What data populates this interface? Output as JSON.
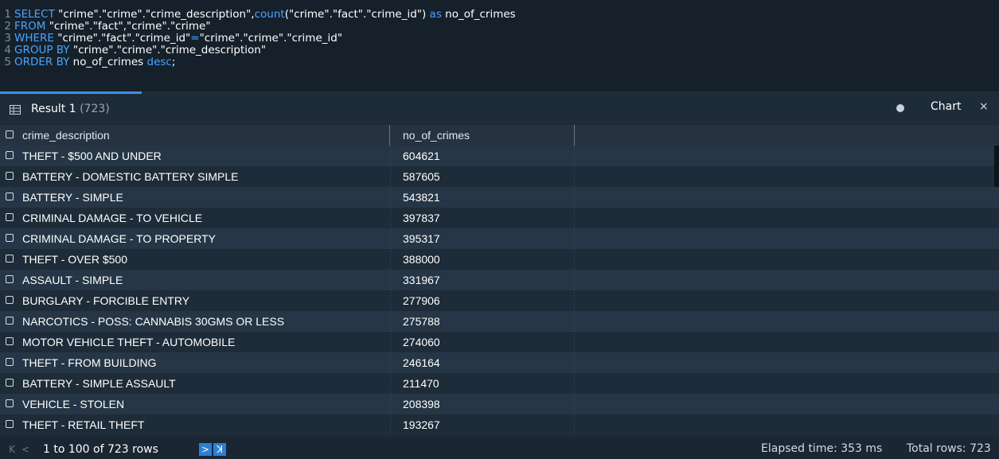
{
  "editor": {
    "lines": [
      {
        "num": "1",
        "parts": [
          {
            "t": "SELECT",
            "k": true
          },
          {
            "t": " \"crime\".\"crime\".\"crime_description\",",
            "k": false
          },
          {
            "t": "count",
            "k": true
          },
          {
            "t": "(\"crime\".\"fact\".\"crime_id\") ",
            "k": false
          },
          {
            "t": "as",
            "k": true
          },
          {
            "t": " no_of_crimes",
            "k": false
          }
        ]
      },
      {
        "num": "2",
        "parts": [
          {
            "t": "FROM",
            "k": true
          },
          {
            "t": " \"crime\".\"fact\",\"crime\".\"crime\"",
            "k": false
          }
        ]
      },
      {
        "num": "3",
        "parts": [
          {
            "t": "WHERE",
            "k": true
          },
          {
            "t": " \"crime\".\"fact\".\"crime_id\"",
            "k": false
          },
          {
            "t": "=",
            "k": true
          },
          {
            "t": "\"crime\".\"crime\".\"crime_id\"",
            "k": false
          }
        ]
      },
      {
        "num": "4",
        "parts": [
          {
            "t": "GROUP BY",
            "k": true
          },
          {
            "t": " \"crime\".\"crime\".\"crime_description\"",
            "k": false
          }
        ]
      },
      {
        "num": "5",
        "parts": [
          {
            "t": "ORDER BY",
            "k": true
          },
          {
            "t": " no_of_crimes ",
            "k": false
          },
          {
            "t": "desc",
            "k": true
          },
          {
            "t": ";",
            "k": false
          }
        ]
      }
    ]
  },
  "result_tab": {
    "label": "Result 1",
    "count": "(723)"
  },
  "chart": {
    "label": "Chart",
    "close": "×"
  },
  "table": {
    "columns": [
      "crime_description",
      "no_of_crimes"
    ],
    "rows": [
      [
        "THEFT - $500 AND UNDER",
        "604621"
      ],
      [
        "BATTERY - DOMESTIC BATTERY SIMPLE",
        "587605"
      ],
      [
        "BATTERY - SIMPLE",
        "543821"
      ],
      [
        "CRIMINAL DAMAGE - TO VEHICLE",
        "397837"
      ],
      [
        "CRIMINAL DAMAGE - TO PROPERTY",
        "395317"
      ],
      [
        "THEFT - OVER $500",
        "388000"
      ],
      [
        "ASSAULT - SIMPLE",
        "331967"
      ],
      [
        "BURGLARY - FORCIBLE ENTRY",
        "277906"
      ],
      [
        "NARCOTICS - POSS: CANNABIS 30GMS OR LESS",
        "275788"
      ],
      [
        "MOTOR VEHICLE THEFT - AUTOMOBILE",
        "274060"
      ],
      [
        "THEFT - FROM BUILDING",
        "246164"
      ],
      [
        "BATTERY - SIMPLE ASSAULT",
        "211470"
      ],
      [
        "VEHICLE - STOLEN",
        "208398"
      ],
      [
        "THEFT - RETAIL THEFT",
        "193267"
      ]
    ]
  },
  "footer": {
    "first": "K",
    "prev": "<",
    "range": "1 to 100 of 723 rows",
    "next": ">",
    "last": "ꓘ",
    "elapsed": "Elapsed time: 353 ms",
    "total": "Total rows: 723"
  },
  "colors": {
    "keyword": "#4aa3ff",
    "accent": "#2d7fd4"
  }
}
